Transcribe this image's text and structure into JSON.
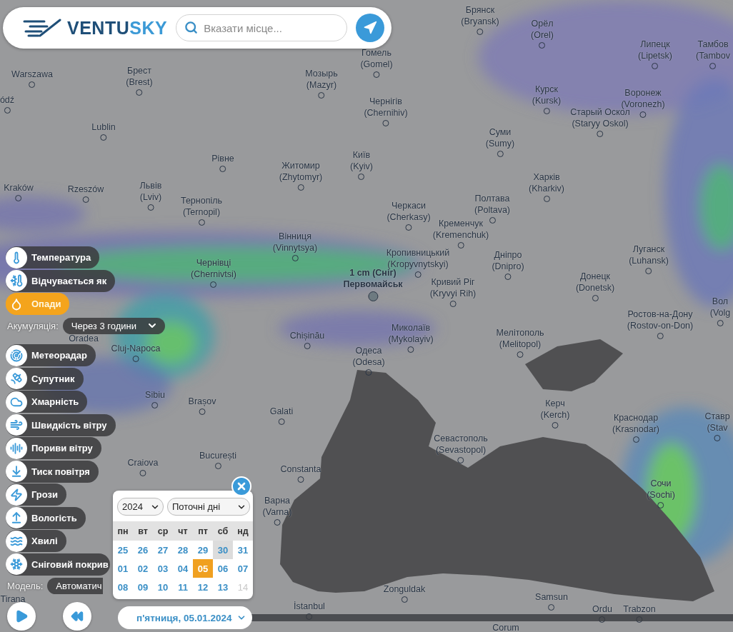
{
  "header": {
    "logo": {
      "first": "VENTU",
      "second": "SKY"
    },
    "search": {
      "placeholder": "Вказати місце..."
    }
  },
  "layers": [
    {
      "label": "Температура",
      "selected": false
    },
    {
      "label": "Відчувається як",
      "selected": false
    },
    {
      "label": "Опади",
      "selected": true,
      "option": {
        "label": "Акумуляція:",
        "value": "Через 3 години"
      }
    },
    {
      "label": "Метеорадар",
      "selected": false
    },
    {
      "label": "Супутник",
      "selected": false
    },
    {
      "label": "Хмарність",
      "selected": false
    },
    {
      "label": "Швидкість вітру",
      "selected": false
    },
    {
      "label": "Пориви вітру",
      "selected": false
    },
    {
      "label": "Тиск повітря",
      "selected": false
    },
    {
      "label": "Грози",
      "selected": false
    },
    {
      "label": "Вологість",
      "selected": false
    },
    {
      "label": "Хвилі",
      "selected": false
    },
    {
      "label": "Сніговий покрив",
      "selected": false
    }
  ],
  "model": {
    "label": "Модель:",
    "value": "Автоматич"
  },
  "map": {
    "cities": [
      {
        "name": "Брянск",
        "latin": "(Bryansk)"
      },
      {
        "name": "Орёл",
        "latin": "(Orel)"
      },
      {
        "name": "Липецк",
        "latin": "(Lipetsk)"
      },
      {
        "name": "Тамбов",
        "latin": "(Tambov"
      },
      {
        "name": "Гомель",
        "latin": "(Gomel)"
      },
      {
        "name": "Warszawa"
      },
      {
        "name": "Брест",
        "latin": "(Brest)"
      },
      {
        "name": "Мозырь",
        "latin": "(Mazyr)"
      },
      {
        "name": "ódź"
      },
      {
        "name": "Чернігів",
        "latin": "(Chernihiv)"
      },
      {
        "name": "Курск",
        "latin": "(Kursk)"
      },
      {
        "name": "Воронеж",
        "latin": "(Voronezh)"
      },
      {
        "name": "Lublin"
      },
      {
        "name": "Старый Оскол",
        "latin": "(Staryy Oskol)"
      },
      {
        "name": "Суми",
        "latin": "(Sumy)"
      },
      {
        "name": "Рівне"
      },
      {
        "name": "Житомир",
        "latin": "(Zhytomyr)"
      },
      {
        "name": "Київ",
        "latin": "(Kyiv)"
      },
      {
        "name": "Kraków"
      },
      {
        "name": "Rzeszów"
      },
      {
        "name": "Львів",
        "latin": "(Lviv)"
      },
      {
        "name": "Тернопіль",
        "latin": "(Ternopil)"
      },
      {
        "name": "Харків",
        "latin": "(Kharkiv)"
      },
      {
        "name": "Полтава",
        "latin": "(Poltava)"
      },
      {
        "name": "Черкаси",
        "latin": "(Cherkasy)"
      },
      {
        "name": "Кременчук",
        "latin": "(Kremenchuk)"
      },
      {
        "name": "Вінниця",
        "latin": "(Vinnytsya)"
      },
      {
        "name": "Кропивницький",
        "latin": "(Kropyvnytskyi)"
      },
      {
        "name": "Дніпро",
        "latin": "(Dnipro)"
      },
      {
        "name": "Луганск",
        "latin": "(Luhansk)"
      },
      {
        "name": "Чернівці",
        "latin": "(Chernivtsi)"
      },
      {
        "name": "Кривий Ріг",
        "latin": "(Kryvyi Rih)"
      },
      {
        "name": "Донецк",
        "latin": "(Donetsk)"
      },
      {
        "name": "Вол",
        "latin": "(Volg"
      },
      {
        "name": "Ростов-на-Дону",
        "latin": "(Rostov-on-Don)"
      },
      {
        "name": "Oradea"
      },
      {
        "name": "Cluj-Napoca"
      },
      {
        "name": "Chișinău"
      },
      {
        "name": "Миколаїв",
        "latin": "(Mykolayiv)"
      },
      {
        "name": "Одеса",
        "latin": "(Odesa)"
      },
      {
        "name": "Мелітополь",
        "latin": "(Melitopol)"
      },
      {
        "name": "Sibiu"
      },
      {
        "name": "Brașov"
      },
      {
        "name": "Galati"
      },
      {
        "name": "Керч",
        "latin": "(Kerch)"
      },
      {
        "name": "Краснодар",
        "latin": "(Krasnodar)"
      },
      {
        "name": "Ставр",
        "latin": "(Stav"
      },
      {
        "name": "Севастополь",
        "latin": "(Sevastopol)"
      },
      {
        "name": "Craiova"
      },
      {
        "name": "București"
      },
      {
        "name": "Constanta"
      },
      {
        "name": "Сочи",
        "latin": "(Sochi)"
      },
      {
        "name": "Варна",
        "latin": "(Varna)"
      },
      {
        "name": "Zonguldak"
      },
      {
        "name": "Samsun"
      },
      {
        "name": "İstanbul"
      },
      {
        "name": "Ordu"
      },
      {
        "name": "Trabzon"
      },
      {
        "name": "Tirana"
      },
      {
        "name": "Corum"
      }
    ],
    "marker": {
      "value": "1 cm (Сніг)",
      "place": "Первомайськ"
    }
  },
  "calendar": {
    "year": "2024",
    "range": "Поточні дні",
    "weekdays": [
      "пн",
      "вт",
      "ср",
      "чт",
      "пт",
      "сб",
      "нд"
    ],
    "weeks": [
      [
        {
          "day": "25",
          "selected": false,
          "highlighted": false,
          "disabled": false
        },
        {
          "day": "26",
          "selected": false,
          "highlighted": false,
          "disabled": false
        },
        {
          "day": "27",
          "selected": false,
          "highlighted": false,
          "disabled": false
        },
        {
          "day": "28",
          "selected": false,
          "highlighted": false,
          "disabled": false
        },
        {
          "day": "29",
          "selected": false,
          "highlighted": false,
          "disabled": false
        },
        {
          "day": "30",
          "selected": false,
          "highlighted": true,
          "disabled": false
        },
        {
          "day": "31",
          "selected": false,
          "highlighted": false,
          "disabled": false
        }
      ],
      [
        {
          "day": "01",
          "selected": false,
          "highlighted": false,
          "disabled": false
        },
        {
          "day": "02",
          "selected": false,
          "highlighted": false,
          "disabled": false
        },
        {
          "day": "03",
          "selected": false,
          "highlighted": false,
          "disabled": false
        },
        {
          "day": "04",
          "selected": false,
          "highlighted": false,
          "disabled": false
        },
        {
          "day": "05",
          "selected": true,
          "highlighted": false,
          "disabled": false
        },
        {
          "day": "06",
          "selected": false,
          "highlighted": false,
          "disabled": false
        },
        {
          "day": "07",
          "selected": false,
          "highlighted": false,
          "disabled": false
        }
      ],
      [
        {
          "day": "08",
          "selected": false,
          "highlighted": false,
          "disabled": false
        },
        {
          "day": "09",
          "selected": false,
          "highlighted": false,
          "disabled": false
        },
        {
          "day": "10",
          "selected": false,
          "highlighted": false,
          "disabled": false
        },
        {
          "day": "11",
          "selected": false,
          "highlighted": false,
          "disabled": false
        },
        {
          "day": "12",
          "selected": false,
          "highlighted": false,
          "disabled": false
        },
        {
          "day": "13",
          "selected": false,
          "highlighted": false,
          "disabled": false
        },
        {
          "day": "14",
          "selected": false,
          "highlighted": false,
          "disabled": true
        }
      ]
    ]
  },
  "date": "п'ятниця, 05.01.2024"
}
